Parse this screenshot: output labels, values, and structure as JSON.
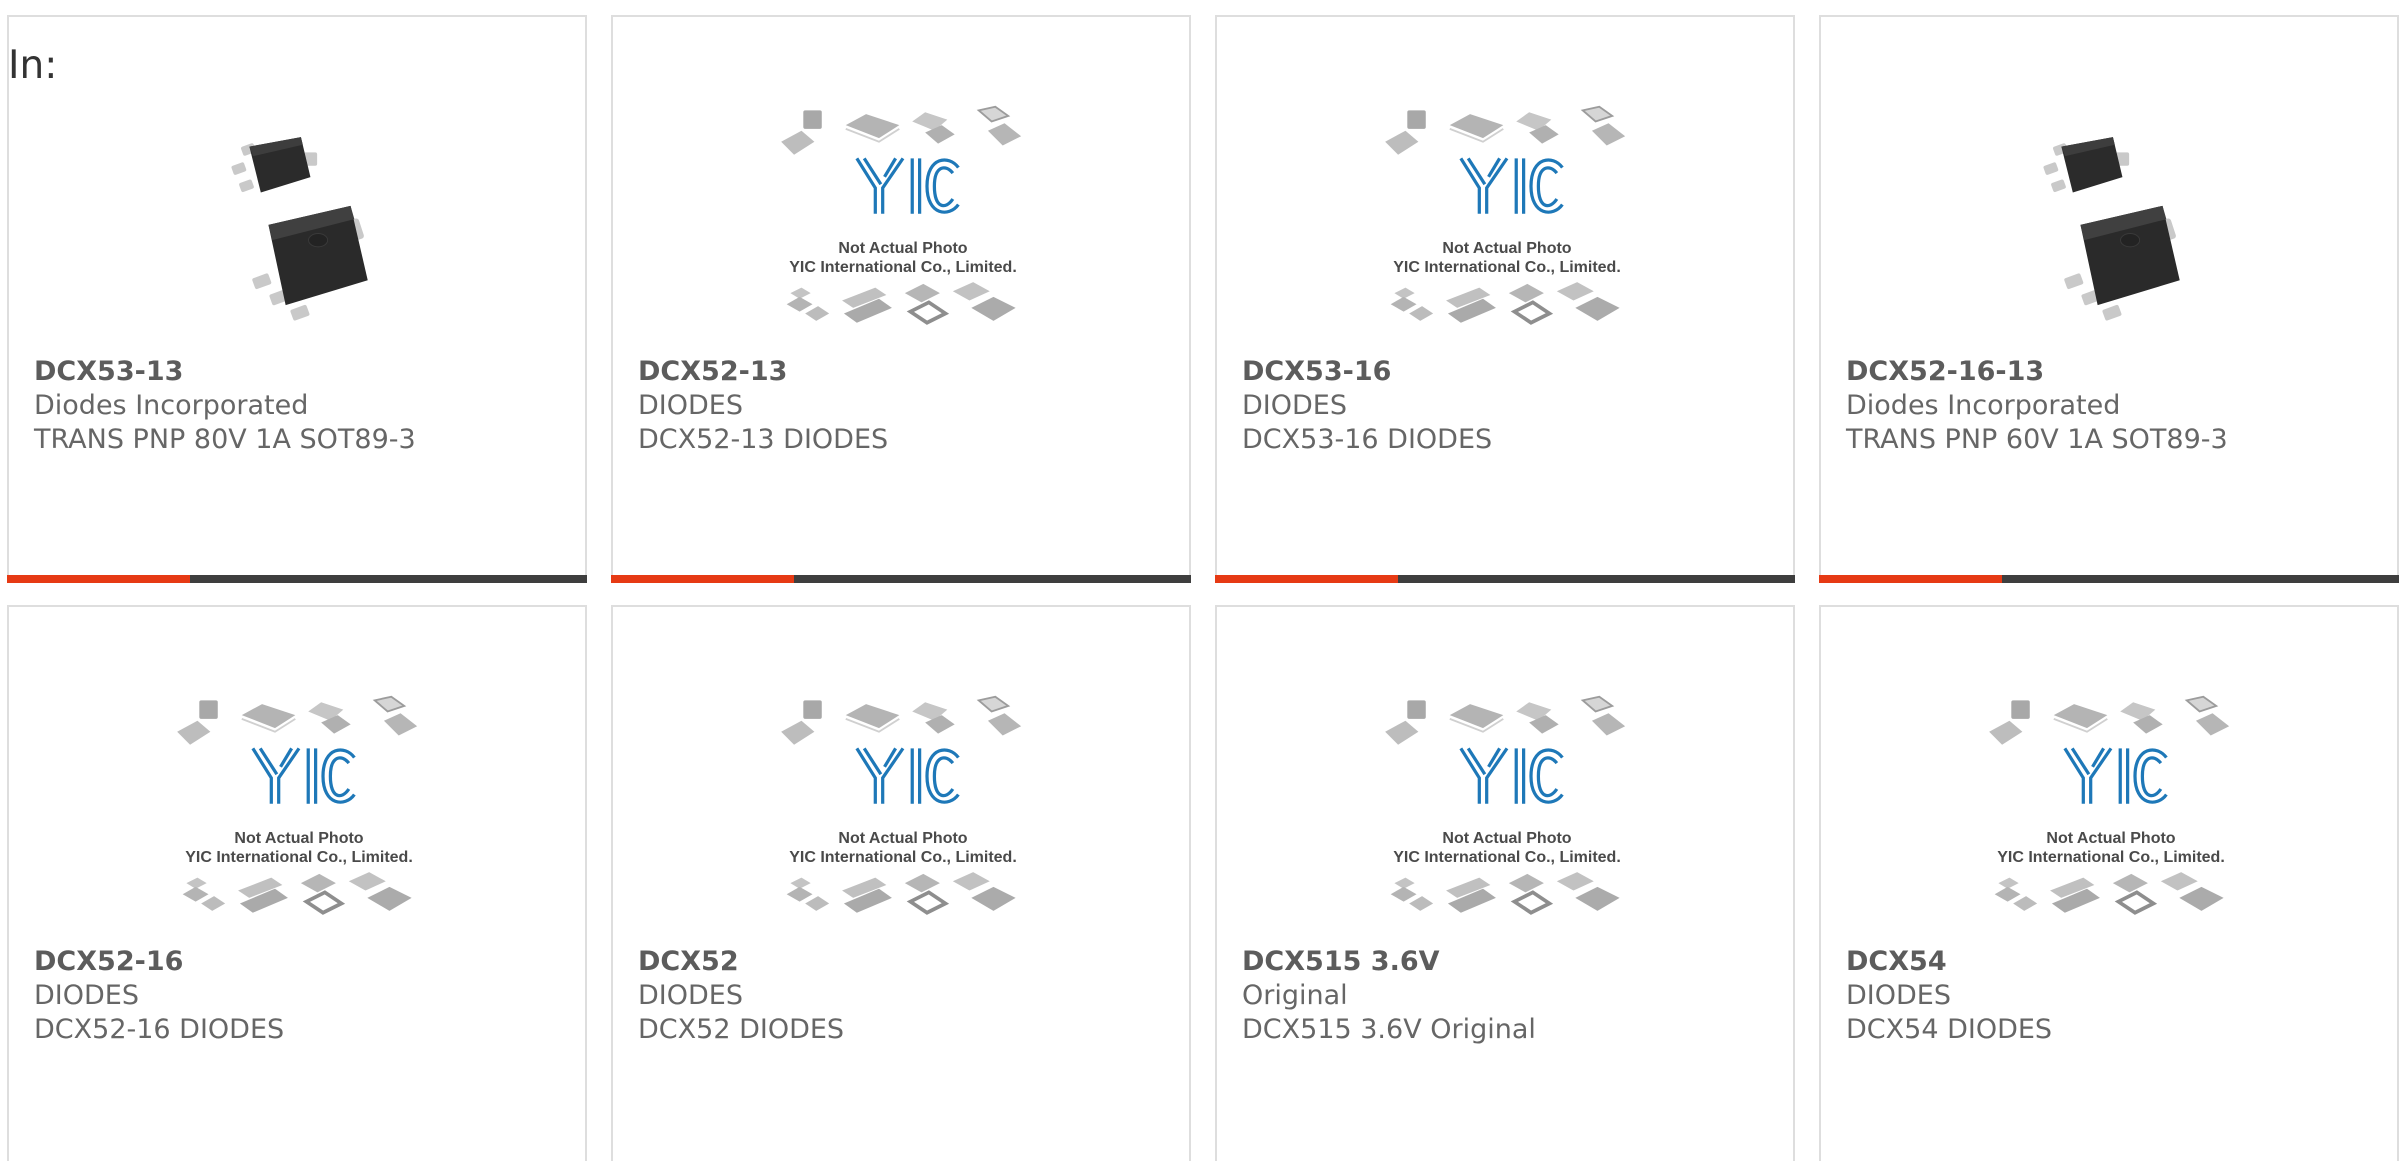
{
  "header": {
    "prefix_label": "In:"
  },
  "colors": {
    "card_border": "#dedede",
    "bar_dark": "#3e3e3e",
    "bar_accent": "#e63a14",
    "text_title": "#5c5c5c",
    "text_body": "#666666"
  },
  "placeholder_image": {
    "line1": "Not Actual Photo",
    "line2": "YIC International Co., Limited."
  },
  "products": [
    {
      "part": "DCX53-13",
      "maker": "Diodes Incorporated",
      "desc": "TRANS PNP 80V 1A SOT89-3",
      "image": "sot89-package-photo"
    },
    {
      "part": "DCX52-13",
      "maker": "DIODES",
      "desc": "DCX52-13 DIODES",
      "image": "yic-placeholder"
    },
    {
      "part": "DCX53-16",
      "maker": "DIODES",
      "desc": "DCX53-16 DIODES",
      "image": "yic-placeholder"
    },
    {
      "part": "DCX52-16-13",
      "maker": "Diodes Incorporated",
      "desc": "TRANS PNP 60V 1A SOT89-3",
      "image": "sot89-package-photo"
    },
    {
      "part": "DCX52-16",
      "maker": "DIODES",
      "desc": "DCX52-16 DIODES",
      "image": "yic-placeholder"
    },
    {
      "part": "DCX52",
      "maker": "DIODES",
      "desc": "DCX52 DIODES",
      "image": "yic-placeholder"
    },
    {
      "part": "DCX515 3.6V",
      "maker": "Original",
      "desc": "DCX515 3.6V Original",
      "image": "yic-placeholder"
    },
    {
      "part": "DCX54",
      "maker": "DIODES",
      "desc": "DCX54 DIODES",
      "image": "yic-placeholder"
    }
  ]
}
